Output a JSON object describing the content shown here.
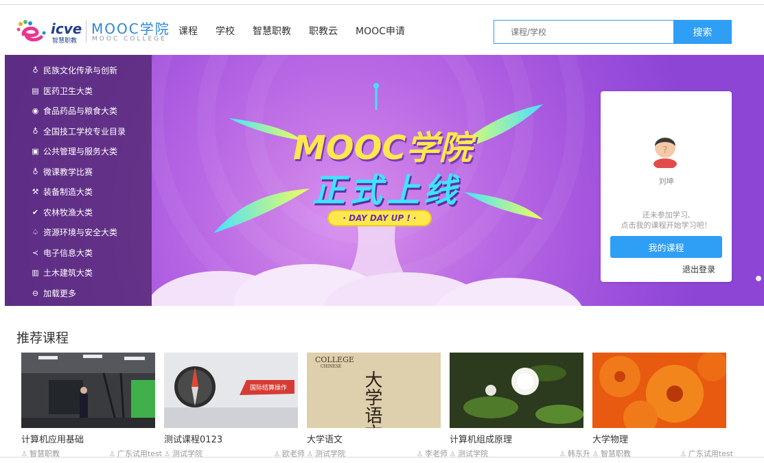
{
  "brand": {
    "icve": "icve",
    "icve_sub": "智慧职教",
    "mooc": "MOOC学院",
    "mooc_sub": "MOOC COLLEGE"
  },
  "nav": [
    "课程",
    "学校",
    "智慧职教",
    "职教云",
    "MOOC申请"
  ],
  "search": {
    "placeholder": "课程/学校",
    "button": "搜索"
  },
  "categories": [
    {
      "icon": "lightbulb-icon",
      "label": "民族文化传承与创新"
    },
    {
      "icon": "medical-icon",
      "label": "医药卫生大类"
    },
    {
      "icon": "food-icon",
      "label": "食品药品与粮食大类"
    },
    {
      "icon": "lightbulb-icon",
      "label": "全国技工学校专业目录"
    },
    {
      "icon": "public-service-icon",
      "label": "公共管理与服务大类"
    },
    {
      "icon": "lightbulb-icon",
      "label": "微课教学比赛"
    },
    {
      "icon": "wrench-icon",
      "label": "装备制造大类"
    },
    {
      "icon": "leaf-icon",
      "label": "农林牧渔大类"
    },
    {
      "icon": "environment-icon",
      "label": "资源环境与安全大类"
    },
    {
      "icon": "share-icon",
      "label": "电子信息大类"
    },
    {
      "icon": "building-icon",
      "label": "土木建筑大类"
    },
    {
      "icon": "minus-circle-icon",
      "label": "加载更多"
    }
  ],
  "hero": {
    "line1": "MOOC学院",
    "line2": "正式上线",
    "pill": "· DAY DAY UP ! ·"
  },
  "user_card": {
    "name": "刘坤",
    "msg1": "还未参加学习,",
    "msg2": "点击我的课程开始学习吧！",
    "button": "我的课程",
    "logout": "退出登录"
  },
  "recommend": {
    "title": "推荐课程",
    "courses": [
      {
        "title": "计算机应用基础",
        "school": "智慧职教",
        "teacher": "广东试用test"
      },
      {
        "title": "测试课程0123",
        "school": "测试学院",
        "teacher": "欧老师"
      },
      {
        "title": "大学语文",
        "school": "测试学院",
        "teacher": "李老师"
      },
      {
        "title": "计算机组成原理",
        "school": "测试学院",
        "teacher": "韩东升"
      },
      {
        "title": "大学物理",
        "school": "智慧职教",
        "teacher": "广东试用test"
      }
    ],
    "thumb_texts": {
      "course2_banner": "国际结算操作",
      "course3_cover": "COLLEGE",
      "course3_cover_sub": "CHINESE",
      "course3_big": "大学语文"
    }
  },
  "colors": {
    "accent": "#2f9ef5",
    "banner": "#b867e4",
    "menu": "#4f266e"
  }
}
